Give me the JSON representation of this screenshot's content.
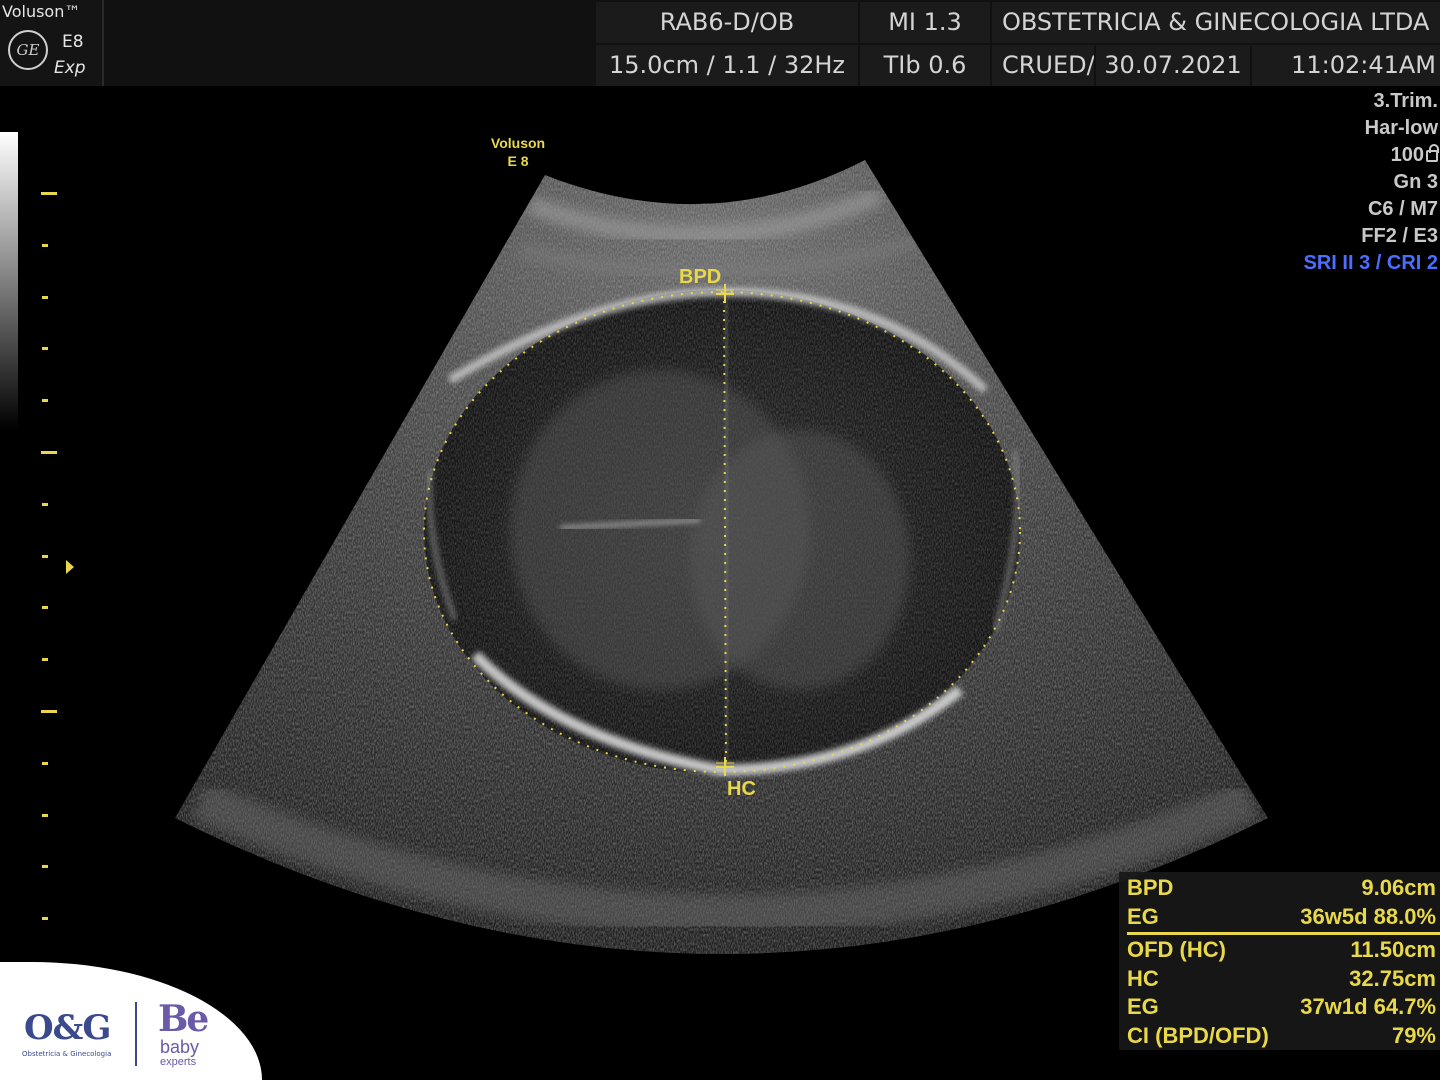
{
  "header": {
    "brand": "Voluson™",
    "logo_text": "GE",
    "model": "E8",
    "mode": "Exp",
    "probe": "RAB6-D/OB",
    "mi": "MI  1.3",
    "institution": "OBSTETRICIA & GINECOLOGIA LTDA",
    "depth_freq": "15.0cm / 1.1 / 32Hz",
    "tib": "TIb  0.6",
    "operator": "CRUED/",
    "date": "30.07.2021",
    "time": "11:02:41AM"
  },
  "params": {
    "trimester": "3.Trim.",
    "harmonic": "Har-low",
    "power": "100",
    "gain": "Gn   3",
    "cm": "C6 / M7",
    "ff": "FF2 / E3",
    "sri": "SRI II 3 / CRI 2"
  },
  "image": {
    "brand_line1": "Voluson",
    "brand_line2": "E 8",
    "caliper_top_label": "BPD",
    "caliper_bottom_label": "HC"
  },
  "measurements": {
    "bpd": {
      "label": "BPD",
      "value": "9.06cm"
    },
    "eg1": {
      "label": "EG",
      "value": "36w5d 88.0%"
    },
    "ofd": {
      "label": "OFD (HC)",
      "value": "11.50cm"
    },
    "hc": {
      "label": "HC",
      "value": "32.75cm"
    },
    "eg2": {
      "label": "EG",
      "value": "37w1d 64.7%"
    },
    "ci": {
      "label": "CI (BPD/OFD)",
      "value": "79%"
    }
  },
  "logos": {
    "og": "O&G",
    "og_sub": "Obstetrícia & Ginecologia",
    "be": "Be",
    "baby": "baby",
    "experts": "experts"
  },
  "colors": {
    "caliper": "#e8d84a",
    "sri": "#4a6fff",
    "header_bg": "#1b1b1b"
  }
}
